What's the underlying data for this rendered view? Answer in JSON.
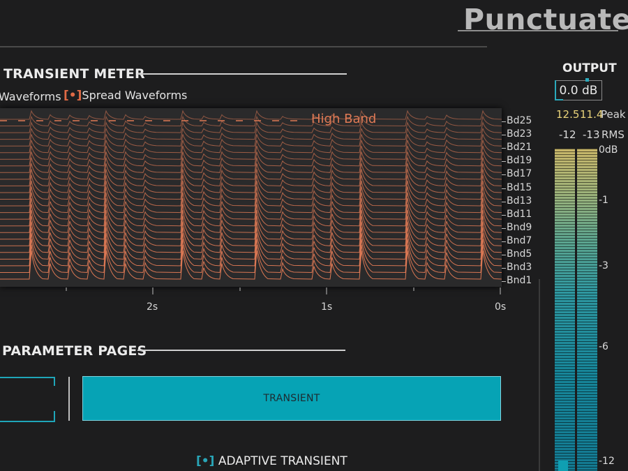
{
  "app": {
    "title": "Punctuate"
  },
  "transient_meter": {
    "title": "TRANSIENT METER",
    "options": [
      {
        "label": "Waveforms",
        "checked": false
      },
      {
        "label": "Spread Waveforms",
        "checked": true
      }
    ],
    "high_band_label": "High Band",
    "band_labels": [
      "Bd25",
      "Bd23",
      "Bd21",
      "Bd19",
      "Bd17",
      "Bd15",
      "Bd13",
      "Bd11",
      "Bnd9",
      "Bnd7",
      "Bnd5",
      "Bnd3",
      "Bnd1"
    ],
    "time_labels": [
      "2s",
      "1s",
      "0s"
    ],
    "colors": {
      "waveform": "#e07a55",
      "background": "#2a2a2b"
    }
  },
  "parameter_pages": {
    "title": "PARAMETER PAGES",
    "active_tab": "TRANSIENT",
    "accent": "#06a3b5"
  },
  "adaptive_transient": {
    "label": "ADAPTIVE TRANSIENT",
    "checked": true
  },
  "output": {
    "title": "OUTPUT",
    "value": "0.0 dB",
    "peak_left": "12.5",
    "peak_right": "11.4",
    "peak_label": "Peak",
    "rms_left": "-12",
    "rms_right": "-13",
    "rms_label": "RMS",
    "scale": [
      "0dB",
      "-1",
      "-3",
      "-6",
      "-12"
    ]
  }
}
